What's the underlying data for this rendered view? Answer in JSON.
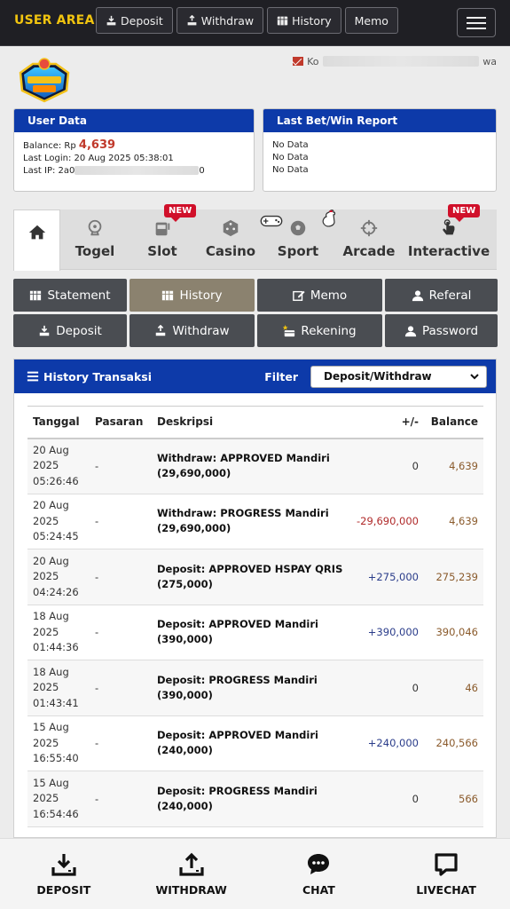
{
  "topbar": {
    "brand": "USER AREA",
    "nav": [
      {
        "label": "Deposit",
        "icon": "deposit-icon"
      },
      {
        "label": "Withdraw",
        "icon": "withdraw-icon"
      },
      {
        "label": "History",
        "icon": "history-icon"
      },
      {
        "label": "Memo",
        "icon": ""
      }
    ]
  },
  "header": {
    "email_prefix": "Ko",
    "email_suffix": "wa"
  },
  "user_data": {
    "title": "User Data",
    "balance_label": "Balance: Rp",
    "balance_value": "4,639",
    "last_login": "Last Login: 20 Aug 2025 05:38:01",
    "last_ip_label": "Last IP: 2a0",
    "last_ip_suffix": "0"
  },
  "report": {
    "title": "Last Bet/Win Report",
    "lines": [
      "No Data",
      "No Data",
      "No Data"
    ]
  },
  "game_tabs": [
    {
      "label": "Togel",
      "new": false
    },
    {
      "label": "Slot",
      "new": true
    },
    {
      "label": "Casino",
      "new": false
    },
    {
      "label": "Sport",
      "new": false
    },
    {
      "label": "Arcade",
      "new": false
    },
    {
      "label": "Interactive",
      "new": true
    }
  ],
  "new_badge": "NEW",
  "actions": [
    "Statement",
    "History",
    "Memo",
    "Referal",
    "Deposit",
    "Withdraw",
    "Rekening",
    "Password"
  ],
  "history": {
    "title": "History Transaksi",
    "filter_label": "Filter",
    "filter_value": "Deposit/Withdraw",
    "columns": [
      "Tanggal",
      "Pasaran",
      "Deskripsi",
      "+/-",
      "Balance"
    ],
    "rows": [
      {
        "date": [
          "20 Aug",
          "2025",
          "05:26:46"
        ],
        "pasaran": "-",
        "desc": [
          "Withdraw: APPROVED Mandiri",
          "(29,690,000)"
        ],
        "change": "0",
        "balance": "4,639"
      },
      {
        "date": [
          "20 Aug",
          "2025",
          "05:24:45"
        ],
        "pasaran": "-",
        "desc": [
          "Withdraw: PROGRESS Mandiri",
          "(29,690,000)"
        ],
        "change": "-29,690,000",
        "balance": "4,639"
      },
      {
        "date": [
          "20 Aug",
          "2025",
          "04:24:26"
        ],
        "pasaran": "-",
        "desc": [
          "Deposit: APPROVED HSPAY QRIS",
          "(275,000)"
        ],
        "change": "+275,000",
        "balance": "275,239"
      },
      {
        "date": [
          "18 Aug",
          "2025",
          "01:44:36"
        ],
        "pasaran": "-",
        "desc": [
          "Deposit: APPROVED Mandiri (390,000)",
          ""
        ],
        "change": "+390,000",
        "balance": "390,046"
      },
      {
        "date": [
          "18 Aug",
          "2025",
          "01:43:41"
        ],
        "pasaran": "-",
        "desc": [
          "Deposit: PROGRESS Mandiri (390,000)",
          ""
        ],
        "change": "0",
        "balance": "46"
      },
      {
        "date": [
          "15 Aug",
          "2025",
          "16:55:40"
        ],
        "pasaran": "-",
        "desc": [
          "Deposit: APPROVED Mandiri (240,000)",
          ""
        ],
        "change": "+240,000",
        "balance": "240,566"
      },
      {
        "date": [
          "15 Aug",
          "2025",
          "16:54:46"
        ],
        "pasaran": "-",
        "desc": [
          "Deposit: PROGRESS Mandiri (240,000)",
          ""
        ],
        "change": "0",
        "balance": "566"
      }
    ]
  },
  "bottom_nav": [
    "DEPOSIT",
    "WITHDRAW",
    "CHAT",
    "LIVECHAT"
  ]
}
